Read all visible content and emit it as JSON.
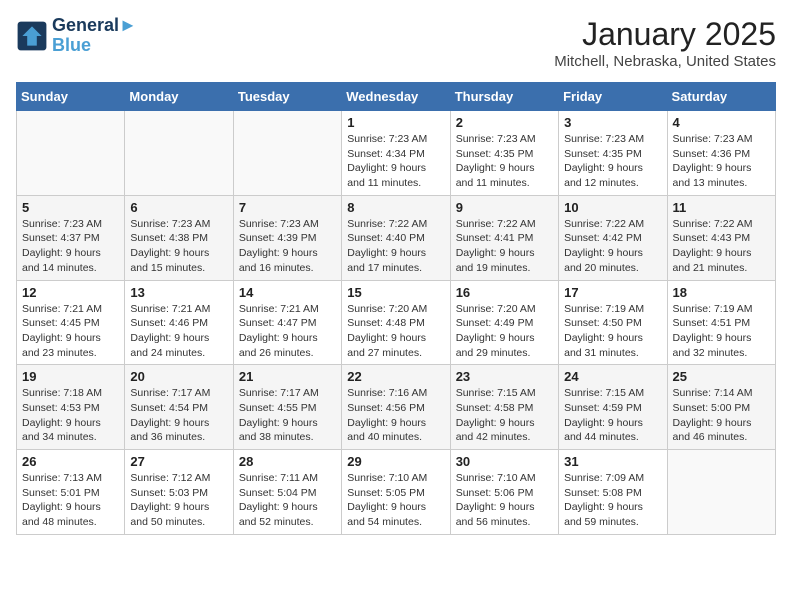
{
  "logo": {
    "line1": "General",
    "line2": "Blue"
  },
  "title": "January 2025",
  "location": "Mitchell, Nebraska, United States",
  "days_of_week": [
    "Sunday",
    "Monday",
    "Tuesday",
    "Wednesday",
    "Thursday",
    "Friday",
    "Saturday"
  ],
  "weeks": [
    [
      {
        "day": "",
        "content": ""
      },
      {
        "day": "",
        "content": ""
      },
      {
        "day": "",
        "content": ""
      },
      {
        "day": "1",
        "content": "Sunrise: 7:23 AM\nSunset: 4:34 PM\nDaylight: 9 hours\nand 11 minutes."
      },
      {
        "day": "2",
        "content": "Sunrise: 7:23 AM\nSunset: 4:35 PM\nDaylight: 9 hours\nand 11 minutes."
      },
      {
        "day": "3",
        "content": "Sunrise: 7:23 AM\nSunset: 4:35 PM\nDaylight: 9 hours\nand 12 minutes."
      },
      {
        "day": "4",
        "content": "Sunrise: 7:23 AM\nSunset: 4:36 PM\nDaylight: 9 hours\nand 13 minutes."
      }
    ],
    [
      {
        "day": "5",
        "content": "Sunrise: 7:23 AM\nSunset: 4:37 PM\nDaylight: 9 hours\nand 14 minutes."
      },
      {
        "day": "6",
        "content": "Sunrise: 7:23 AM\nSunset: 4:38 PM\nDaylight: 9 hours\nand 15 minutes."
      },
      {
        "day": "7",
        "content": "Sunrise: 7:23 AM\nSunset: 4:39 PM\nDaylight: 9 hours\nand 16 minutes."
      },
      {
        "day": "8",
        "content": "Sunrise: 7:22 AM\nSunset: 4:40 PM\nDaylight: 9 hours\nand 17 minutes."
      },
      {
        "day": "9",
        "content": "Sunrise: 7:22 AM\nSunset: 4:41 PM\nDaylight: 9 hours\nand 19 minutes."
      },
      {
        "day": "10",
        "content": "Sunrise: 7:22 AM\nSunset: 4:42 PM\nDaylight: 9 hours\nand 20 minutes."
      },
      {
        "day": "11",
        "content": "Sunrise: 7:22 AM\nSunset: 4:43 PM\nDaylight: 9 hours\nand 21 minutes."
      }
    ],
    [
      {
        "day": "12",
        "content": "Sunrise: 7:21 AM\nSunset: 4:45 PM\nDaylight: 9 hours\nand 23 minutes."
      },
      {
        "day": "13",
        "content": "Sunrise: 7:21 AM\nSunset: 4:46 PM\nDaylight: 9 hours\nand 24 minutes."
      },
      {
        "day": "14",
        "content": "Sunrise: 7:21 AM\nSunset: 4:47 PM\nDaylight: 9 hours\nand 26 minutes."
      },
      {
        "day": "15",
        "content": "Sunrise: 7:20 AM\nSunset: 4:48 PM\nDaylight: 9 hours\nand 27 minutes."
      },
      {
        "day": "16",
        "content": "Sunrise: 7:20 AM\nSunset: 4:49 PM\nDaylight: 9 hours\nand 29 minutes."
      },
      {
        "day": "17",
        "content": "Sunrise: 7:19 AM\nSunset: 4:50 PM\nDaylight: 9 hours\nand 31 minutes."
      },
      {
        "day": "18",
        "content": "Sunrise: 7:19 AM\nSunset: 4:51 PM\nDaylight: 9 hours\nand 32 minutes."
      }
    ],
    [
      {
        "day": "19",
        "content": "Sunrise: 7:18 AM\nSunset: 4:53 PM\nDaylight: 9 hours\nand 34 minutes."
      },
      {
        "day": "20",
        "content": "Sunrise: 7:17 AM\nSunset: 4:54 PM\nDaylight: 9 hours\nand 36 minutes."
      },
      {
        "day": "21",
        "content": "Sunrise: 7:17 AM\nSunset: 4:55 PM\nDaylight: 9 hours\nand 38 minutes."
      },
      {
        "day": "22",
        "content": "Sunrise: 7:16 AM\nSunset: 4:56 PM\nDaylight: 9 hours\nand 40 minutes."
      },
      {
        "day": "23",
        "content": "Sunrise: 7:15 AM\nSunset: 4:58 PM\nDaylight: 9 hours\nand 42 minutes."
      },
      {
        "day": "24",
        "content": "Sunrise: 7:15 AM\nSunset: 4:59 PM\nDaylight: 9 hours\nand 44 minutes."
      },
      {
        "day": "25",
        "content": "Sunrise: 7:14 AM\nSunset: 5:00 PM\nDaylight: 9 hours\nand 46 minutes."
      }
    ],
    [
      {
        "day": "26",
        "content": "Sunrise: 7:13 AM\nSunset: 5:01 PM\nDaylight: 9 hours\nand 48 minutes."
      },
      {
        "day": "27",
        "content": "Sunrise: 7:12 AM\nSunset: 5:03 PM\nDaylight: 9 hours\nand 50 minutes."
      },
      {
        "day": "28",
        "content": "Sunrise: 7:11 AM\nSunset: 5:04 PM\nDaylight: 9 hours\nand 52 minutes."
      },
      {
        "day": "29",
        "content": "Sunrise: 7:10 AM\nSunset: 5:05 PM\nDaylight: 9 hours\nand 54 minutes."
      },
      {
        "day": "30",
        "content": "Sunrise: 7:10 AM\nSunset: 5:06 PM\nDaylight: 9 hours\nand 56 minutes."
      },
      {
        "day": "31",
        "content": "Sunrise: 7:09 AM\nSunset: 5:08 PM\nDaylight: 9 hours\nand 59 minutes."
      },
      {
        "day": "",
        "content": ""
      }
    ]
  ]
}
